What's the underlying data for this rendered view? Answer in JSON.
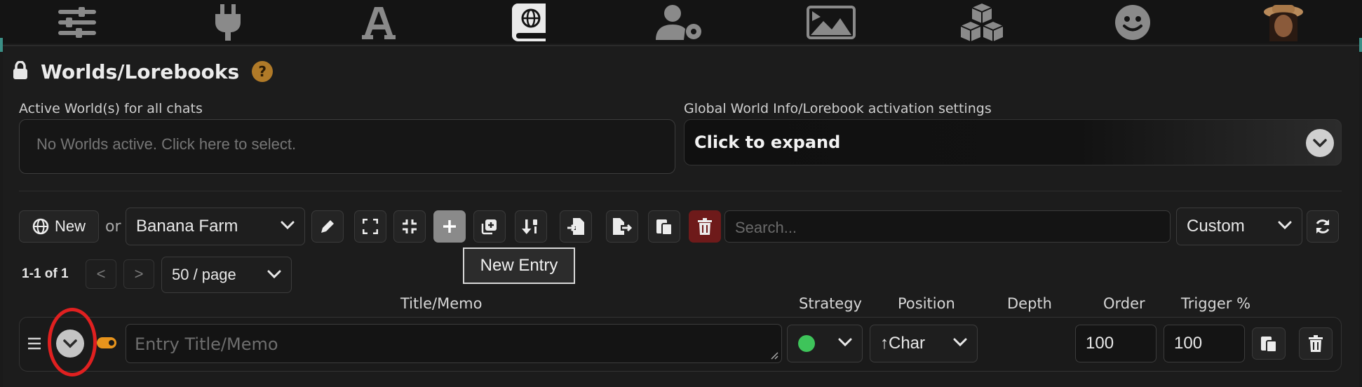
{
  "nav": {
    "icons": [
      "sliders-icon",
      "plug-icon",
      "font-icon",
      "book-globe-icon",
      "user-gear-icon",
      "image-icon",
      "cubes-icon",
      "smiley-icon",
      "avatar"
    ]
  },
  "header": {
    "title": "Worlds/Lorebooks",
    "help": "?"
  },
  "active_worlds": {
    "label": "Active World(s) for all chats",
    "placeholder": "No Worlds active. Click here to select."
  },
  "global_settings": {
    "label": "Global World Info/Lorebook activation settings",
    "expand_text": "Click to expand"
  },
  "toolbar": {
    "new_label": "New",
    "or_label": "or",
    "world_select": "Banana Farm",
    "search_placeholder": "Search...",
    "sort_select": "Custom",
    "tooltip": "New Entry"
  },
  "pagination": {
    "range": "1-1 of 1",
    "prev": "<",
    "next": ">",
    "per_page": "50 / page"
  },
  "columns": {
    "title_memo": "Title/Memo",
    "strategy": "Strategy",
    "position": "Position",
    "depth": "Depth",
    "order": "Order",
    "trigger": "Trigger %"
  },
  "entry": {
    "title_placeholder": "Entry Title/Memo",
    "position": "↑Char",
    "order": "100",
    "trigger": "100"
  },
  "colors": {
    "accent_teal": "#3b8f86",
    "help_orange": "#b07a28",
    "strategy_green": "#3ec45a",
    "delete_red": "#6e1a1a",
    "annotation_red": "#e02020"
  }
}
